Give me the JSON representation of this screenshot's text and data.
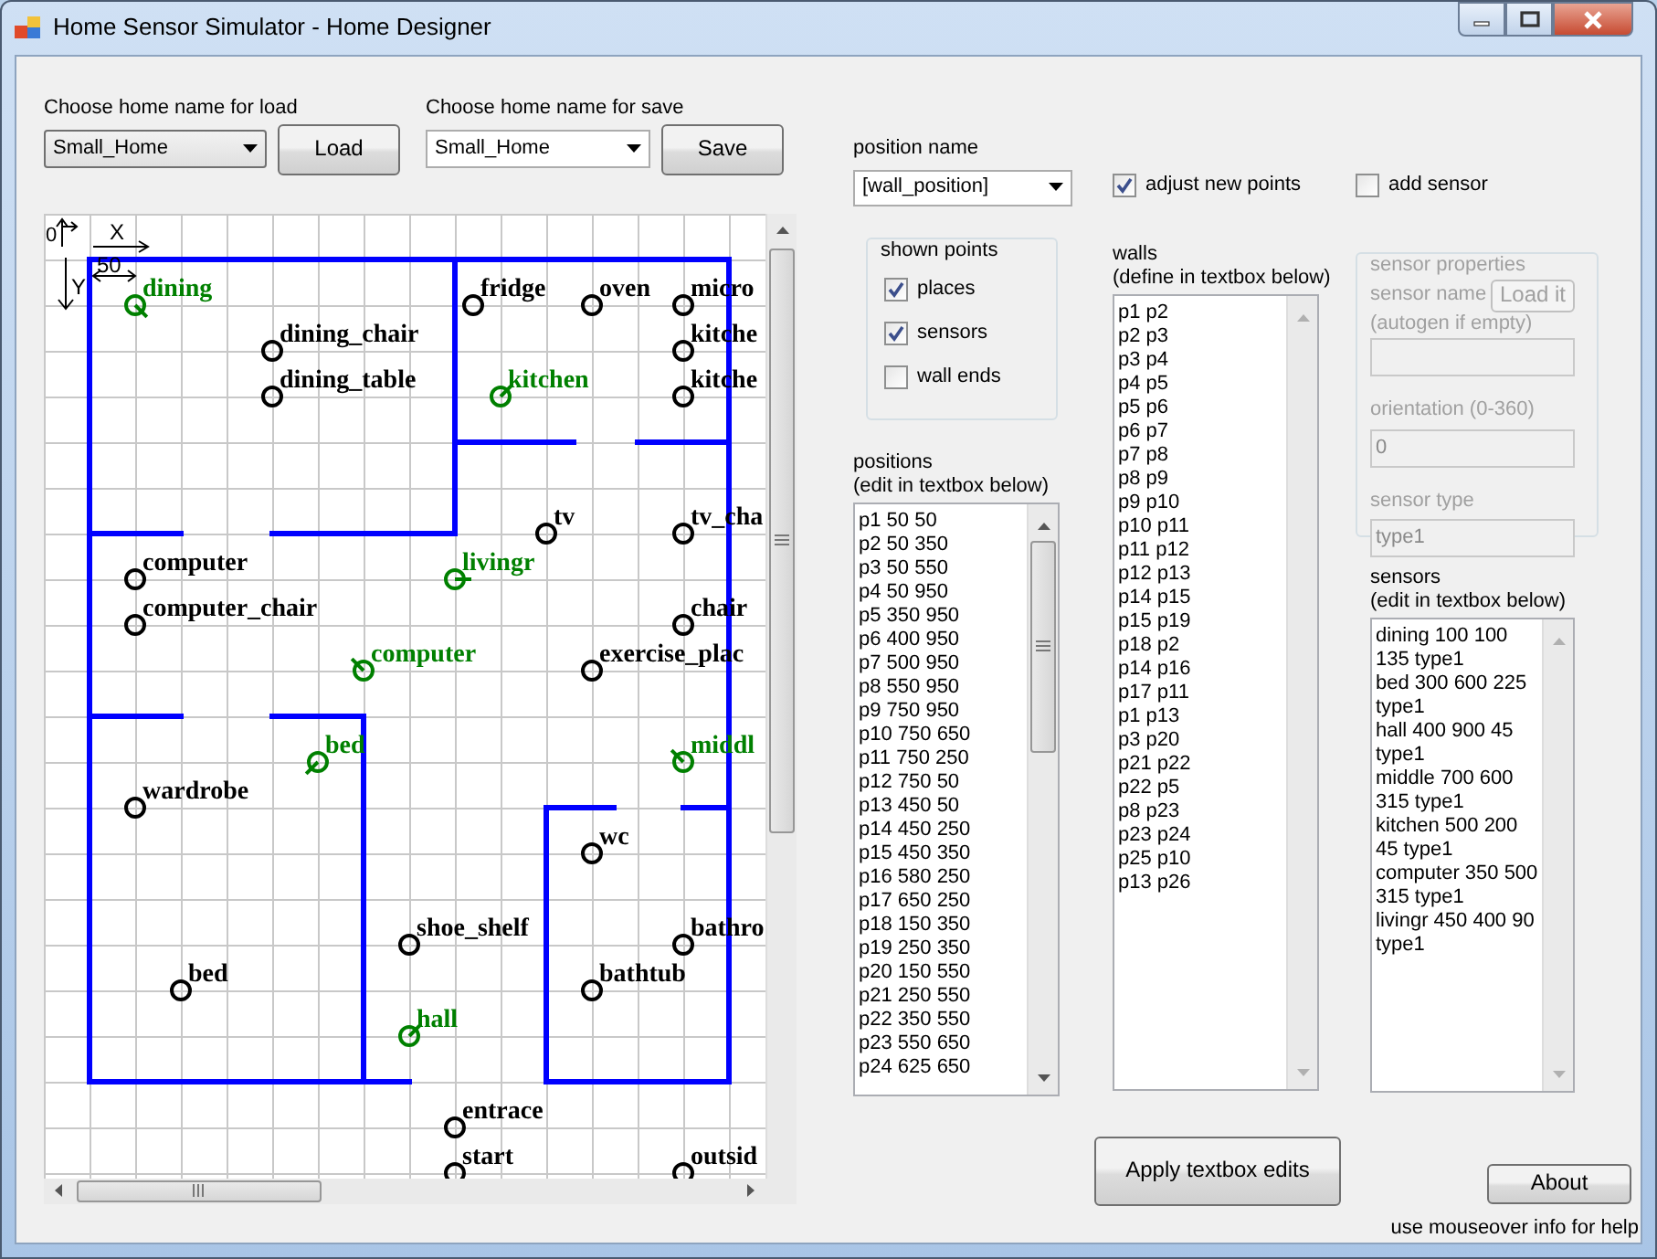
{
  "window": {
    "title": "Home Sensor Simulator - Home Designer"
  },
  "load": {
    "label": "Choose home name for load",
    "value": "Small_Home",
    "button": "Load"
  },
  "save": {
    "label": "Choose home name for save",
    "value": "Small_Home",
    "button": "Save"
  },
  "map": {
    "axes": {
      "origin": "0",
      "x": "X",
      "y": "Y",
      "scale": "50"
    },
    "places": [
      {
        "label": "fridge"
      },
      {
        "label": "oven"
      },
      {
        "label": "micro"
      },
      {
        "label": "dining_chair"
      },
      {
        "label": "kitche"
      },
      {
        "label": "dining_table"
      },
      {
        "label": "kitche"
      },
      {
        "label": "tv"
      },
      {
        "label": "tv_cha"
      },
      {
        "label": "computer"
      },
      {
        "label": "computer_chair"
      },
      {
        "label": "chair"
      },
      {
        "label": "exercise_plac"
      },
      {
        "label": "wardrobe"
      },
      {
        "label": "wc"
      },
      {
        "label": "shoe_shelf"
      },
      {
        "label": "bathro"
      },
      {
        "label": "bed"
      },
      {
        "label": "bathtub"
      },
      {
        "label": "entrace"
      },
      {
        "label": "start"
      },
      {
        "label": "outsid"
      }
    ],
    "sensors": [
      {
        "label": "dining"
      },
      {
        "label": "kitchen"
      },
      {
        "label": "livingr"
      },
      {
        "label": "computer"
      },
      {
        "label": "bed"
      },
      {
        "label": "middl"
      },
      {
        "label": "hall"
      }
    ]
  },
  "position_name": {
    "label": "position name",
    "value": "[wall_position]"
  },
  "adjust_new_points": {
    "label": "adjust new points",
    "checked": true
  },
  "add_sensor": {
    "label": "add sensor",
    "checked": false
  },
  "shown_points": {
    "title": "shown points",
    "options": [
      {
        "label": "places",
        "checked": true
      },
      {
        "label": "sensors",
        "checked": true
      },
      {
        "label": "wall ends",
        "checked": false
      }
    ]
  },
  "positions": {
    "label": "positions",
    "hint": "(edit in textbox below)",
    "lines": [
      "p1 50 50",
      "p2 50 350",
      "p3 50 550",
      "p4 50 950",
      "p5 350 950",
      "p6 400 950",
      "p7 500 950",
      "p8 550 950",
      "p9 750 950",
      "p10 750 650",
      "p11 750 250",
      "p12 750 50",
      "p13 450 50",
      "p14 450 250",
      "p15 450 350",
      "p16 580 250",
      "p17 650 250",
      "p18 150 350",
      "p19 250 350",
      "p20 150 550",
      "p21 250 550",
      "p22 350 550",
      "p23 550 650",
      "p24 625 650"
    ]
  },
  "walls": {
    "label": "walls",
    "hint": "(define in textbox below)",
    "lines": [
      "p1 p2",
      "p2 p3",
      "p3 p4",
      "p4 p5",
      "p5 p6",
      "p6 p7",
      "p7 p8",
      "p8 p9",
      "p9 p10",
      "p10 p11",
      "p11 p12",
      "p12 p13",
      "p14 p15",
      "p15 p19",
      "p18 p2",
      "p14 p16",
      "p17 p11",
      "p1 p13",
      "p3 p20",
      "p21 p22",
      "p22 p5",
      "p8 p23",
      "p23 p24",
      "p25 p10",
      "p13 p26"
    ]
  },
  "sensor_properties": {
    "title": "sensor properties",
    "disabled": true,
    "name_label": "sensor name",
    "load_button": "Load it",
    "name_hint": "(autogen if empty)",
    "orientation_label": "orientation (0-360)",
    "orientation_value": "0",
    "type_label": "sensor type",
    "type_value": "type1"
  },
  "sensors": {
    "label": "sensors",
    "hint": "(edit in textbox below)",
    "lines": [
      "dining 100 100",
      "135 type1",
      "bed 300 600 225",
      "type1",
      "hall 400 900 45",
      "type1",
      "middle 700 600",
      "315 type1",
      "kitchen 500 200",
      "45 type1",
      "computer 350 500",
      "315 type1",
      "livingr 450 400 90",
      "type1"
    ]
  },
  "apply_button": "Apply textbox edits",
  "about_button": "About",
  "help_text": "use mouseover info for help"
}
